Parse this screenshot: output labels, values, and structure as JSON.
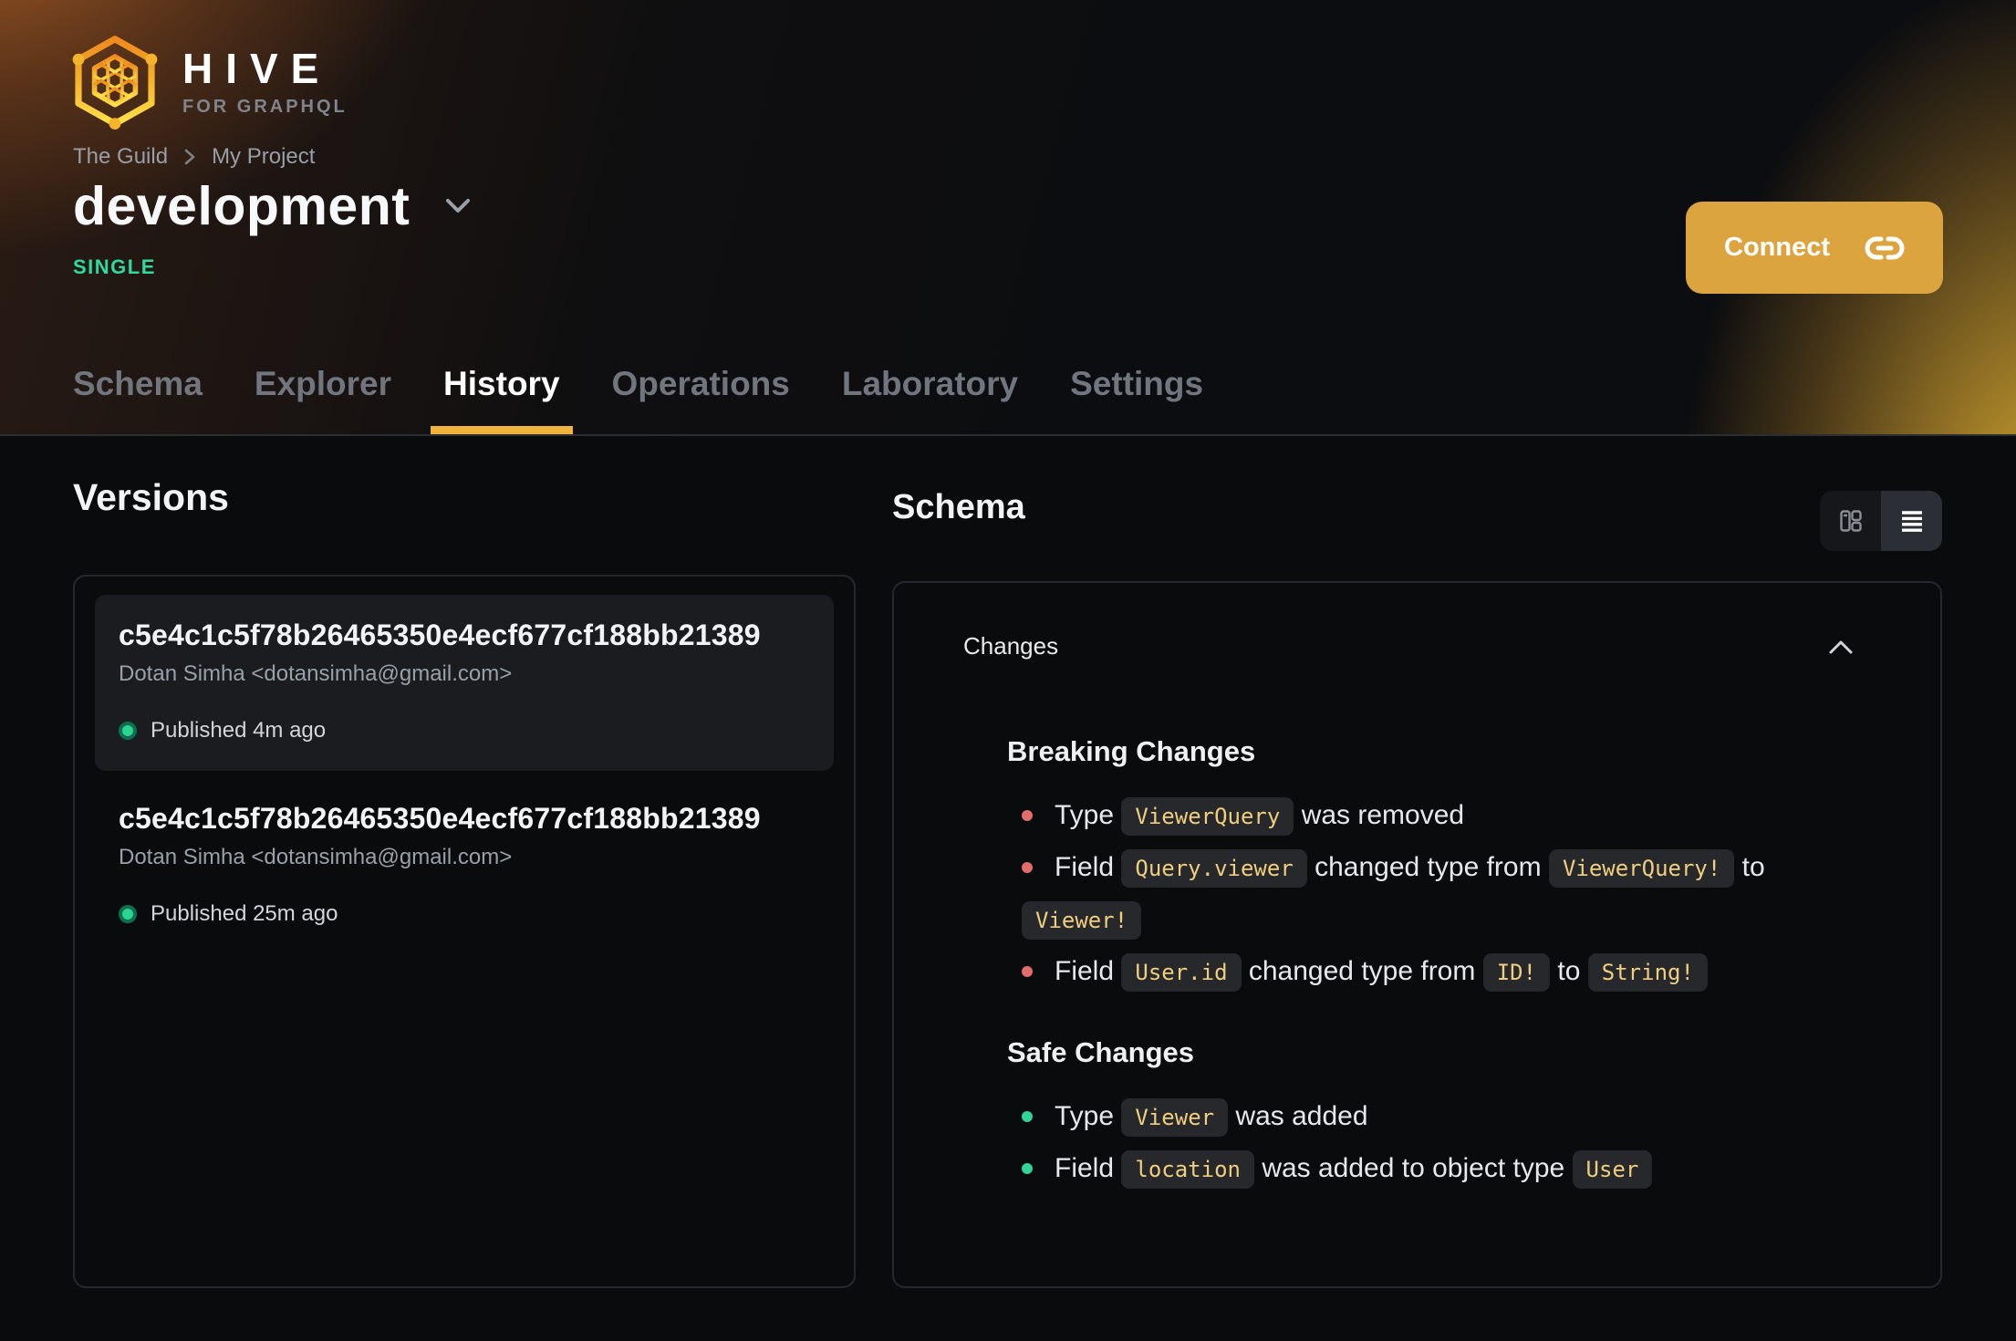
{
  "brand": {
    "name": "HIVE",
    "tagline": "FOR GRAPHQL"
  },
  "breadcrumb": {
    "org": "The Guild",
    "project": "My Project"
  },
  "target": {
    "name": "development",
    "badge": "SINGLE"
  },
  "connect": {
    "label": "Connect"
  },
  "tabs": [
    "Schema",
    "Explorer",
    "History",
    "Operations",
    "Laboratory",
    "Settings"
  ],
  "active_tab": "History",
  "versions": {
    "heading": "Versions",
    "items": [
      {
        "hash": "c5e4c1c5f78b26465350e4ecf677cf188bb21389",
        "author": "Dotan Simha <dotansimha@gmail.com>",
        "status": "Published 4m ago"
      },
      {
        "hash": "c5e4c1c5f78b26465350e4ecf677cf188bb21389",
        "author": "Dotan Simha <dotansimha@gmail.com>",
        "status": "Published 25m ago"
      }
    ]
  },
  "schema_view": {
    "heading": "Schema",
    "toggles": [
      "diff-view",
      "list-view"
    ],
    "active_toggle": "list-view"
  },
  "changes": {
    "heading": "Changes",
    "breaking": {
      "heading": "Breaking Changes",
      "items": [
        {
          "p0": "Type",
          "c0": "ViewerQuery",
          "p1": "was removed"
        },
        {
          "p0": "Field",
          "c0": "Query.viewer",
          "p1": "changed type from",
          "c1": "ViewerQuery!",
          "p2": "to",
          "c2": "Viewer!"
        },
        {
          "p0": "Field",
          "c0": "User.id",
          "p1": "changed type from",
          "c1": "ID!",
          "p2": "to",
          "c2": "String!"
        }
      ]
    },
    "safe": {
      "heading": "Safe Changes",
      "items": [
        {
          "p0": "Type",
          "c0": "Viewer",
          "p1": "was added"
        },
        {
          "p0": "Field",
          "c0": "location",
          "p1": "was added to object type",
          "c1": "User"
        }
      ]
    }
  },
  "colors": {
    "accent_amber": "#dba43e",
    "tab_underline": "#f0b43e",
    "badge_green": "#2fd9a0",
    "published_dot": "#2bd591",
    "breaking_bullet": "#e26d6d",
    "safe_bullet": "#33d39a",
    "chip_bg": "#26282c",
    "chip_text": "#efce7e"
  }
}
